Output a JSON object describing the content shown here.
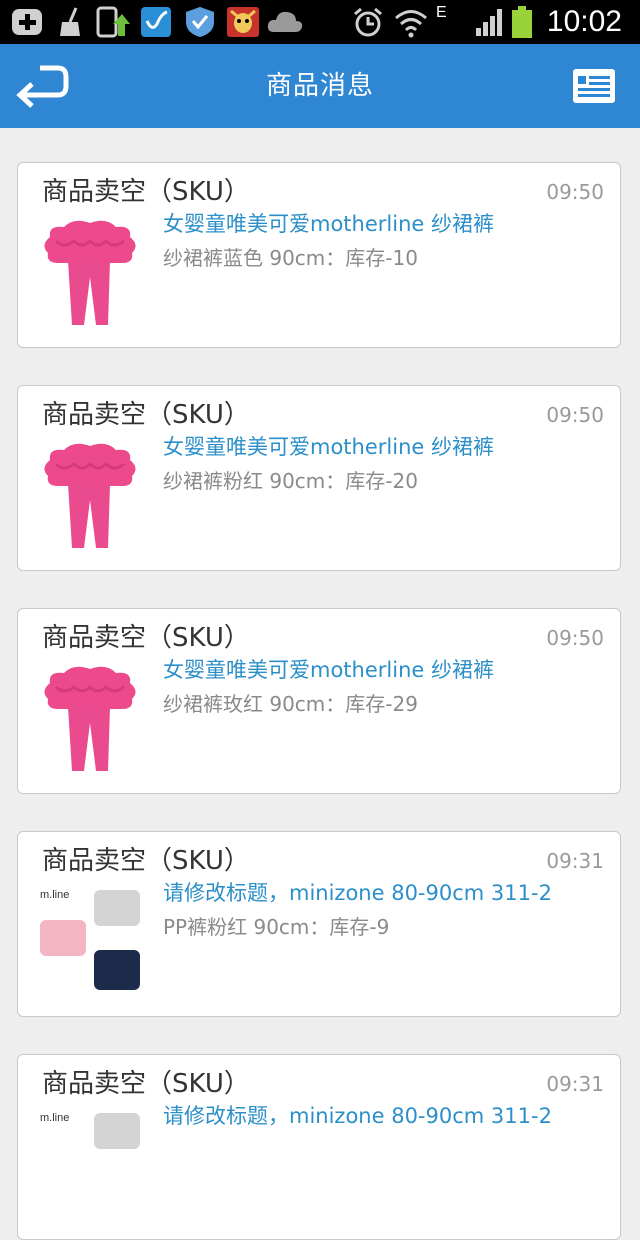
{
  "status_bar": {
    "time": "10:02",
    "network_type": "E",
    "icons": [
      "add-icon",
      "broom-icon",
      "app-update-icon",
      "check-app-icon",
      "shield-icon",
      "cow-app-icon",
      "cloud-icon",
      "alarm-icon",
      "wifi-icon",
      "signal-icon",
      "battery-icon"
    ]
  },
  "header": {
    "title": "商品消息",
    "back_icon": "back-arrow-icon",
    "menu_icon": "list-icon"
  },
  "colors": {
    "header_bg": "#2f86d3",
    "link": "#2b8fc9",
    "thumb_pink": "#ec4a8d"
  },
  "messages": [
    {
      "title": "商品卖空（SKU）",
      "time": "09:50",
      "product": "女婴童唯美可爱motherline 纱裙裤",
      "detail": "纱裙裤蓝色 90cm：库存-10",
      "thumb": "pink-tutu-leggings"
    },
    {
      "title": "商品卖空（SKU）",
      "time": "09:50",
      "product": "女婴童唯美可爱motherline 纱裙裤",
      "detail": "纱裙裤粉红 90cm：库存-20",
      "thumb": "pink-tutu-leggings"
    },
    {
      "title": "商品卖空（SKU）",
      "time": "09:50",
      "product": "女婴童唯美可爱motherline 纱裙裤",
      "detail": "纱裙裤玫红 90cm：库存-29",
      "thumb": "pink-tutu-leggings"
    },
    {
      "title": "商品卖空（SKU）",
      "time": "09:31",
      "product": "请修改标题，minizone 80-90cm 311-2",
      "detail": "PP裤粉红 90cm：库存-9",
      "thumb": "mline-pp-pants",
      "thumb_brand": "m.line"
    },
    {
      "title": "商品卖空（SKU）",
      "time": "09:31",
      "product": "请修改标题，minizone 80-90cm 311-2",
      "detail": "",
      "thumb": "mline-pp-pants",
      "thumb_brand": "m.line"
    }
  ]
}
